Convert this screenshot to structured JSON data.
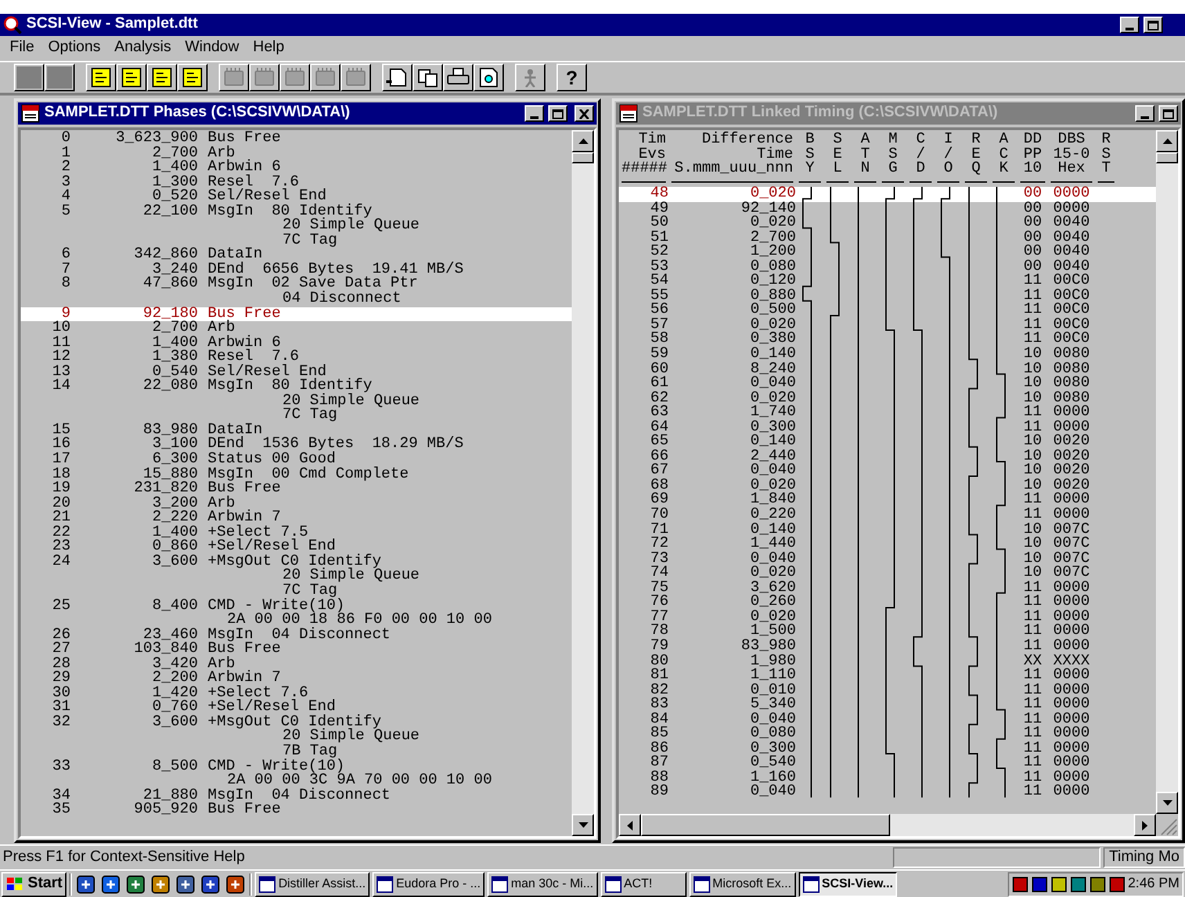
{
  "app": {
    "title": "SCSI-View - Samplet.dtt"
  },
  "menu": [
    {
      "label": "File"
    },
    {
      "label": "Options"
    },
    {
      "label": "Analysis"
    },
    {
      "label": "Window"
    },
    {
      "label": "Help"
    }
  ],
  "toolbar": [
    {
      "kind": "blank",
      "disabled": false
    },
    {
      "kind": "blank",
      "disabled": false
    },
    {
      "kind": "doc",
      "disabled": false
    },
    {
      "kind": "doc",
      "disabled": false
    },
    {
      "kind": "doc",
      "disabled": false
    },
    {
      "kind": "doc",
      "disabled": false
    },
    {
      "kind": "chip",
      "disabled": true
    },
    {
      "kind": "chip",
      "disabled": true
    },
    {
      "kind": "chip",
      "disabled": true
    },
    {
      "kind": "chip",
      "disabled": true
    },
    {
      "kind": "chip",
      "disabled": true
    },
    {
      "kind": "page",
      "disabled": false
    },
    {
      "kind": "copy",
      "disabled": false
    },
    {
      "kind": "print",
      "disabled": false
    },
    {
      "kind": "preview",
      "disabled": false
    },
    {
      "kind": "tool",
      "disabled": true
    },
    {
      "kind": "help",
      "label": "?",
      "disabled": false
    }
  ],
  "phases_window": {
    "title": "SAMPLET.DTT Phases (C:\\SCSIVW\\DATA\\)",
    "active": true,
    "rows": [
      {
        "index": "0",
        "time": "3_623_900",
        "event": "Bus Free",
        "selected": false
      },
      {
        "index": "1",
        "time": "2_700",
        "event": "Arb",
        "selected": false
      },
      {
        "index": "2",
        "time": "1_400",
        "event": "Arbwin 6",
        "selected": false
      },
      {
        "index": "3",
        "time": "1_300",
        "event": "Resel  7.6",
        "selected": false
      },
      {
        "index": "4",
        "time": "0_520",
        "event": "Sel/Resel End",
        "selected": false
      },
      {
        "index": "5",
        "time": "22_100",
        "event": "MsgIn  80 Identify",
        "details": [
          {
            "kind": "message",
            "text": "20 Simple Queue"
          },
          {
            "kind": "message",
            "text": "7C Tag"
          }
        ],
        "selected": false
      },
      {
        "index": "6",
        "time": "342_860",
        "event": "DataIn",
        "selected": false
      },
      {
        "index": "7",
        "time": "3_240",
        "event": "DEnd  6656 Bytes  19.41 MB/S",
        "selected": false
      },
      {
        "index": "8",
        "time": "47_860",
        "event": "MsgIn  02 Save Data Ptr",
        "details": [
          {
            "kind": "message",
            "text": "04 Disconnect"
          }
        ],
        "selected": false
      },
      {
        "index": "9",
        "time": "92_180",
        "event": "Bus Free",
        "selected": true
      },
      {
        "index": "10",
        "time": "2_700",
        "event": "Arb",
        "selected": false
      },
      {
        "index": "11",
        "time": "1_400",
        "event": "Arbwin 6",
        "selected": false
      },
      {
        "index": "12",
        "time": "1_380",
        "event": "Resel  7.6",
        "selected": false
      },
      {
        "index": "13",
        "time": "0_540",
        "event": "Sel/Resel End",
        "selected": false
      },
      {
        "index": "14",
        "time": "22_080",
        "event": "MsgIn  80 Identify",
        "details": [
          {
            "kind": "message",
            "text": "20 Simple Queue"
          },
          {
            "kind": "message",
            "text": "7C Tag"
          }
        ],
        "selected": false
      },
      {
        "index": "15",
        "time": "83_980",
        "event": "DataIn",
        "selected": false
      },
      {
        "index": "16",
        "time": "3_100",
        "event": "DEnd  1536 Bytes  18.29 MB/S",
        "selected": false
      },
      {
        "index": "17",
        "time": "6_300",
        "event": "Status 00 Good",
        "selected": false
      },
      {
        "index": "18",
        "time": "15_880",
        "event": "MsgIn  00 Cmd Complete",
        "selected": false
      },
      {
        "index": "19",
        "time": "231_820",
        "event": "Bus Free",
        "selected": false
      },
      {
        "index": "20",
        "time": "3_200",
        "event": "Arb",
        "selected": false
      },
      {
        "index": "21",
        "time": "2_220",
        "event": "Arbwin 7",
        "selected": false
      },
      {
        "index": "22",
        "time": "1_400",
        "event": "+Select 7.5",
        "selected": false
      },
      {
        "index": "23",
        "time": "0_860",
        "event": "+Sel/Resel End",
        "selected": false
      },
      {
        "index": "24",
        "time": "3_600",
        "event": "+MsgOut C0 Identify",
        "details": [
          {
            "kind": "message",
            "text": "20 Simple Queue"
          },
          {
            "kind": "message",
            "text": "7C Tag"
          }
        ],
        "selected": false
      },
      {
        "index": "25",
        "time": "8_400",
        "event": "CMD - Write(10)",
        "details": [
          {
            "kind": "bytes",
            "text": "2A 00 00 18 86 F0 00 00 10 00"
          }
        ],
        "selected": false
      },
      {
        "index": "26",
        "time": "23_460",
        "event": "MsgIn  04 Disconnect",
        "selected": false
      },
      {
        "index": "27",
        "time": "103_840",
        "event": "Bus Free",
        "selected": false
      },
      {
        "index": "28",
        "time": "3_420",
        "event": "Arb",
        "selected": false
      },
      {
        "index": "29",
        "time": "2_200",
        "event": "Arbwin 7",
        "selected": false
      },
      {
        "index": "30",
        "time": "1_420",
        "event": "+Select 7.6",
        "selected": false
      },
      {
        "index": "31",
        "time": "0_760",
        "event": "+Sel/Resel End",
        "selected": false
      },
      {
        "index": "32",
        "time": "3_600",
        "event": "+MsgOut C0 Identify",
        "details": [
          {
            "kind": "message",
            "text": "20 Simple Queue"
          },
          {
            "kind": "message",
            "text": "7B Tag"
          }
        ],
        "selected": false
      },
      {
        "index": "33",
        "time": "8_500",
        "event": "CMD - Write(10)",
        "details": [
          {
            "kind": "bytes",
            "text": "2A 00 00 3C 9A 70 00 00 10 00"
          }
        ],
        "selected": false
      },
      {
        "index": "34",
        "time": "21_880",
        "event": "MsgIn  04 Disconnect",
        "selected": false
      },
      {
        "index": "35",
        "time": "905_920",
        "event": "Bus Free",
        "selected": false
      }
    ]
  },
  "timing_window": {
    "title": "SAMPLET.DTT Linked Timing (C:\\SCSIVW\\DATA\\)",
    "active": false,
    "columns": [
      {
        "kind": "index",
        "lines": [
          "Tim",
          "Evs",
          "#####"
        ]
      },
      {
        "kind": "time",
        "lines": [
          "Difference",
          "Time",
          "S.mmm_uuu_nnn"
        ]
      },
      {
        "kind": "signal",
        "lines": [
          "B",
          "S",
          "Y"
        ]
      },
      {
        "kind": "signal",
        "lines": [
          "S",
          "E",
          "L"
        ]
      },
      {
        "kind": "signal",
        "lines": [
          "A",
          "T",
          "N"
        ]
      },
      {
        "kind": "signal",
        "lines": [
          "M",
          "S",
          "G"
        ]
      },
      {
        "kind": "signal",
        "lines": [
          "C",
          "/",
          "D"
        ]
      },
      {
        "kind": "signal",
        "lines": [
          "I",
          "/",
          "O"
        ]
      },
      {
        "kind": "signal",
        "lines": [
          "R",
          "E",
          "Q"
        ]
      },
      {
        "kind": "signal",
        "lines": [
          "A",
          "C",
          "K"
        ]
      },
      {
        "kind": "dd",
        "lines": [
          "DD",
          "PP",
          "10"
        ]
      },
      {
        "kind": "dbs",
        "lines": [
          "DBS",
          "15-0",
          "Hex"
        ]
      },
      {
        "kind": "signal",
        "lines": [
          "R",
          "S",
          "T"
        ]
      }
    ],
    "rows": [
      {
        "index": "48",
        "time": "0_020",
        "dd": "00",
        "dbs": "0000",
        "selected": true
      },
      {
        "index": "49",
        "time": "92_140",
        "dd": "00",
        "dbs": "0000",
        "selected": false
      },
      {
        "index": "50",
        "time": "0_020",
        "dd": "00",
        "dbs": "0040",
        "selected": false
      },
      {
        "index": "51",
        "time": "2_700",
        "dd": "00",
        "dbs": "0040",
        "selected": false
      },
      {
        "index": "52",
        "time": "1_200",
        "dd": "00",
        "dbs": "0040",
        "selected": false
      },
      {
        "index": "53",
        "time": "0_080",
        "dd": "00",
        "dbs": "0040",
        "selected": false
      },
      {
        "index": "54",
        "time": "0_120",
        "dd": "11",
        "dbs": "00C0",
        "selected": false
      },
      {
        "index": "55",
        "time": "0_880",
        "dd": "11",
        "dbs": "00C0",
        "selected": false
      },
      {
        "index": "56",
        "time": "0_500",
        "dd": "11",
        "dbs": "00C0",
        "selected": false
      },
      {
        "index": "57",
        "time": "0_020",
        "dd": "11",
        "dbs": "00C0",
        "selected": false
      },
      {
        "index": "58",
        "time": "0_380",
        "dd": "11",
        "dbs": "00C0",
        "selected": false
      },
      {
        "index": "59",
        "time": "0_140",
        "dd": "10",
        "dbs": "0080",
        "selected": false
      },
      {
        "index": "60",
        "time": "8_240",
        "dd": "10",
        "dbs": "0080",
        "selected": false
      },
      {
        "index": "61",
        "time": "0_040",
        "dd": "10",
        "dbs": "0080",
        "selected": false
      },
      {
        "index": "62",
        "time": "0_020",
        "dd": "10",
        "dbs": "0080",
        "selected": false
      },
      {
        "index": "63",
        "time": "1_740",
        "dd": "11",
        "dbs": "0000",
        "selected": false
      },
      {
        "index": "64",
        "time": "0_300",
        "dd": "11",
        "dbs": "0000",
        "selected": false
      },
      {
        "index": "65",
        "time": "0_140",
        "dd": "10",
        "dbs": "0020",
        "selected": false
      },
      {
        "index": "66",
        "time": "2_440",
        "dd": "10",
        "dbs": "0020",
        "selected": false
      },
      {
        "index": "67",
        "time": "0_040",
        "dd": "10",
        "dbs": "0020",
        "selected": false
      },
      {
        "index": "68",
        "time": "0_020",
        "dd": "10",
        "dbs": "0020",
        "selected": false
      },
      {
        "index": "69",
        "time": "1_840",
        "dd": "11",
        "dbs": "0000",
        "selected": false
      },
      {
        "index": "70",
        "time": "0_220",
        "dd": "11",
        "dbs": "0000",
        "selected": false
      },
      {
        "index": "71",
        "time": "0_140",
        "dd": "10",
        "dbs": "007C",
        "selected": false
      },
      {
        "index": "72",
        "time": "1_440",
        "dd": "10",
        "dbs": "007C",
        "selected": false
      },
      {
        "index": "73",
        "time": "0_040",
        "dd": "10",
        "dbs": "007C",
        "selected": false
      },
      {
        "index": "74",
        "time": "0_020",
        "dd": "10",
        "dbs": "007C",
        "selected": false
      },
      {
        "index": "75",
        "time": "3_620",
        "dd": "11",
        "dbs": "0000",
        "selected": false
      },
      {
        "index": "76",
        "time": "0_260",
        "dd": "11",
        "dbs": "0000",
        "selected": false
      },
      {
        "index": "77",
        "time": "0_020",
        "dd": "11",
        "dbs": "0000",
        "selected": false
      },
      {
        "index": "78",
        "time": "1_500",
        "dd": "11",
        "dbs": "0000",
        "selected": false
      },
      {
        "index": "79",
        "time": "83_980",
        "dd": "11",
        "dbs": "0000",
        "selected": false
      },
      {
        "index": "80",
        "time": "1_980",
        "dd": "XX",
        "dbs": "XXXX",
        "selected": false
      },
      {
        "index": "81",
        "time": "1_110",
        "dd": "11",
        "dbs": "0000",
        "selected": false
      },
      {
        "index": "82",
        "time": "0_010",
        "dd": "11",
        "dbs": "0000",
        "selected": false
      },
      {
        "index": "83",
        "time": "5_340",
        "dd": "11",
        "dbs": "0000",
        "selected": false
      },
      {
        "index": "84",
        "time": "0_040",
        "dd": "11",
        "dbs": "0000",
        "selected": false
      },
      {
        "index": "85",
        "time": "0_080",
        "dd": "11",
        "dbs": "0000",
        "selected": false
      },
      {
        "index": "86",
        "time": "0_300",
        "dd": "11",
        "dbs": "0000",
        "selected": false
      },
      {
        "index": "87",
        "time": "0_540",
        "dd": "11",
        "dbs": "0000",
        "selected": false
      },
      {
        "index": "88",
        "time": "1_160",
        "dd": "11",
        "dbs": "0000",
        "selected": false
      },
      {
        "index": "89",
        "time": "0_040",
        "dd": "11",
        "dbs": "0000",
        "selected": false
      }
    ]
  },
  "status_bar": {
    "message": "Press F1 for Context-Sensitive Help",
    "panel": "Timing Mo"
  },
  "taskbar": {
    "start": "Start",
    "tasks": [
      {
        "label": "Distiller Assist...",
        "selected": false
      },
      {
        "label": "Eudora Pro - ...",
        "selected": false
      },
      {
        "label": "man 30c - Mi...",
        "selected": false
      },
      {
        "label": "ACT!",
        "selected": false
      },
      {
        "label": "Microsoft Ex...",
        "selected": false
      },
      {
        "label": "SCSI-View...",
        "selected": true
      }
    ],
    "clock": "2:46 PM"
  }
}
